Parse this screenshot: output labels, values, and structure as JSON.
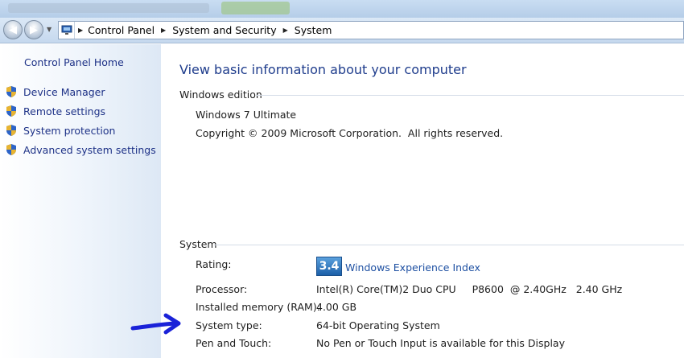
{
  "navigation": {
    "breadcrumbs": [
      "Control Panel",
      "System and Security",
      "System"
    ]
  },
  "sidebar": {
    "home": "Control Panel Home",
    "tasks": [
      {
        "label": "Device Manager"
      },
      {
        "label": "Remote settings"
      },
      {
        "label": "System protection"
      },
      {
        "label": "Advanced system settings"
      }
    ]
  },
  "main": {
    "title": "View basic information about your computer",
    "edition": {
      "heading": "Windows edition",
      "name": "Windows 7 Ultimate",
      "copyright": "Copyright © 2009 Microsoft Corporation.  All rights reserved."
    },
    "system": {
      "heading": "System",
      "rating_label": "Rating:",
      "rating_score": "3.4",
      "rating_link": "Windows Experience Index",
      "rows": [
        {
          "label": "Processor:",
          "value": "Intel(R) Core(TM)2 Duo CPU     P8600  @ 2.40GHz   2.40 GHz"
        },
        {
          "label": "Installed memory (RAM):",
          "value": "4.00 GB"
        },
        {
          "label": "System type:",
          "value": "64-bit Operating System"
        },
        {
          "label": "Pen and Touch:",
          "value": "No Pen or Touch Input is available for this Display"
        }
      ]
    }
  },
  "colors": {
    "link": "#1e3287",
    "title": "#1e3c8c",
    "annotation_arrow": "#1a22d8"
  }
}
